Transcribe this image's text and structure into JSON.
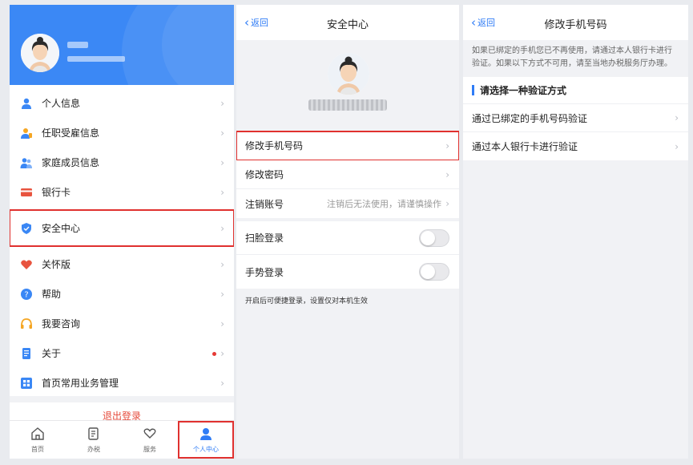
{
  "panel1": {
    "menu": [
      {
        "label": "个人信息",
        "icon": "person-icon"
      },
      {
        "label": "任职受雇信息",
        "icon": "employee-icon"
      },
      {
        "label": "家庭成员信息",
        "icon": "family-icon"
      },
      {
        "label": "银行卡",
        "icon": "bank-card-icon"
      },
      {
        "label": "安全中心",
        "icon": "shield-icon"
      },
      {
        "label": "关怀版",
        "icon": "heart-icon"
      },
      {
        "label": "帮助",
        "icon": "help-icon"
      },
      {
        "label": "我要咨询",
        "icon": "headset-icon"
      },
      {
        "label": "关于",
        "icon": "document-icon"
      },
      {
        "label": "首页常用业务管理",
        "icon": "grid-icon"
      }
    ],
    "logout": "退出登录",
    "tabs": [
      {
        "label": "首页",
        "icon": "home-icon"
      },
      {
        "label": "办税",
        "icon": "edit-doc-icon"
      },
      {
        "label": "服务",
        "icon": "heart-hand-icon"
      },
      {
        "label": "个人中心",
        "icon": "user-icon"
      }
    ]
  },
  "panel2": {
    "back": "返回",
    "title": "安全中心",
    "rows": [
      {
        "label": "修改手机号码"
      },
      {
        "label": "修改密码"
      },
      {
        "label": "注销账号",
        "value": "注销后无法使用，请谨慎操作"
      }
    ],
    "toggles": [
      {
        "label": "扫脸登录"
      },
      {
        "label": "手势登录"
      }
    ],
    "tip": "开启后可便捷登录，设置仅对本机生效"
  },
  "panel3": {
    "back": "返回",
    "title": "修改手机号码",
    "notice": "如果已绑定的手机您已不再使用，请通过本人银行卡进行验证。如果以下方式不可用，请至当地办税服务厅办理。",
    "section": "请选择一种验证方式",
    "options": [
      {
        "label": "通过已绑定的手机号码验证"
      },
      {
        "label": "通过本人银行卡进行验证"
      }
    ]
  },
  "colors": {
    "accent": "#2f7cf6",
    "highlight": "#e0312f",
    "header": "#3b88f5"
  }
}
